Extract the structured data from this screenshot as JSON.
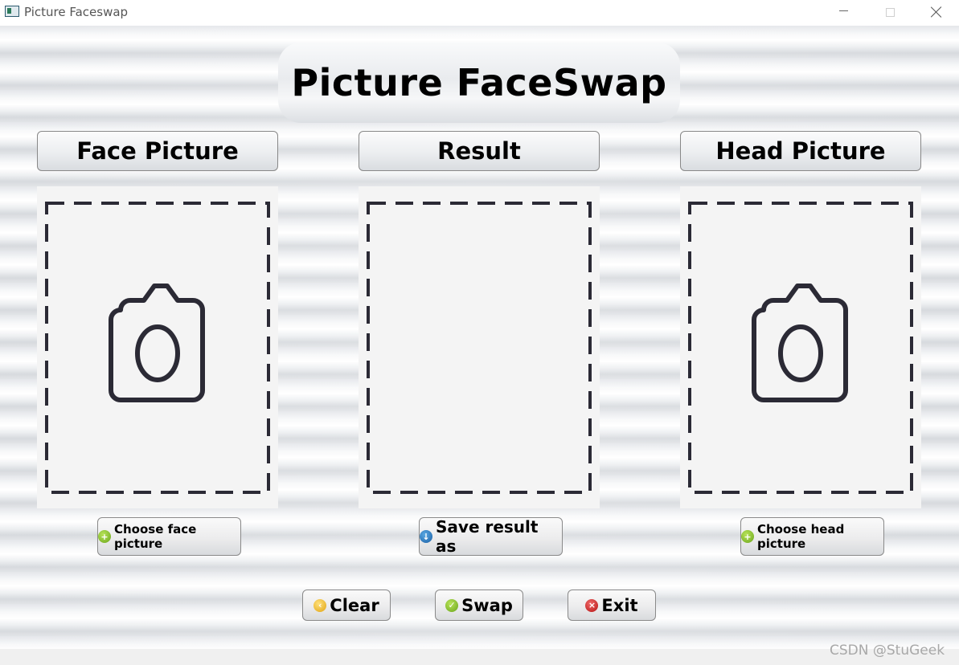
{
  "window": {
    "title": "Picture Faceswap",
    "controls": [
      "minimize-icon",
      "maximize-icon",
      "close-icon"
    ]
  },
  "main": {
    "title": "Picture FaceSwap"
  },
  "sections": {
    "face": {
      "header": "Face Picture",
      "icon": "camera-icon",
      "button_label": "Choose face picture",
      "button_icon": "plus-circle-icon"
    },
    "result": {
      "header": "Result",
      "button_label": "Save result as",
      "button_icon": "download-circle-icon"
    },
    "head": {
      "header": "Head Picture",
      "icon": "camera-icon",
      "button_label": "Choose head picture",
      "button_icon": "plus-circle-icon"
    }
  },
  "actions": {
    "clear_label": "Clear",
    "swap_label": "Swap",
    "exit_label": "Exit",
    "clear_icon": "back-circle-icon",
    "swap_icon": "check-circle-icon",
    "exit_icon": "x-circle-icon"
  },
  "watermark": "CSDN @StuGeek",
  "colors": {
    "panel_bg": "#f4f4f4",
    "dash": "#2b2a35",
    "green_icon": "#6aa51a",
    "blue_icon": "#1a5fa5",
    "yellow_icon": "#e0a413",
    "red_icon": "#b51212"
  }
}
